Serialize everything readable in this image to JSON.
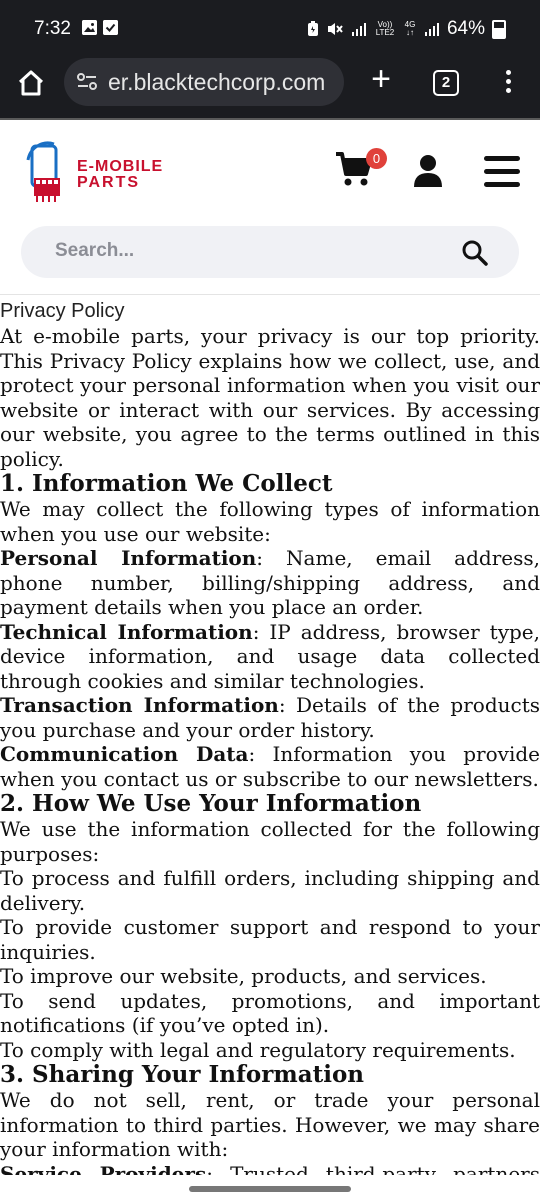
{
  "status": {
    "time": "7:32",
    "lte_top": "Vo))",
    "lte_bottom": "LTE2",
    "net_top": "4G",
    "battery": "64%"
  },
  "browser": {
    "url": "er.blacktechcorp.com",
    "tab_count": "2"
  },
  "site": {
    "logo_line1": "E-MOBILE",
    "logo_line2": "PARTS",
    "cart_count": "0",
    "search_placeholder": "Search..."
  },
  "policy": {
    "title": "Privacy Policy",
    "intro": "At e-mobile parts, your privacy is our top priority. This Privacy Policy explains how we collect, use, and protect your personal information when you visit our website or interact with our services. By accessing our website, you agree to the terms outlined in this policy.",
    "s1_heading": "1. Information We Collect",
    "s1_intro": "We may collect the following types of information when you use our website:",
    "s1_items": [
      {
        "label": "Personal Information",
        "text": ": Name, email address, phone number, billing/shipping address, and payment details when you place an order."
      },
      {
        "label": "Technical Information",
        "text": ": IP address, browser type, device information, and usage data collected through cookies and similar technologies."
      },
      {
        "label": "Transaction Information",
        "text": ": Details of the products you purchase and your order history."
      },
      {
        "label": "Communication Data",
        "text": ": Information you provide when you contact us or subscribe to our newsletters."
      }
    ],
    "s2_heading": "2. How We Use Your Information",
    "s2_intro": "We use the information collected for the following purposes:",
    "s2_items": [
      "To process and fulfill orders, including shipping and delivery.",
      "To provide customer support and respond to your inquiries.",
      "To improve our website, products, and services.",
      "To send updates, promotions, and important notifications (if you’ve opted in).",
      "To comply with legal and regulatory requirements."
    ],
    "s3_heading": "3. Sharing Your Information",
    "s3_intro": "We do not sell, rent, or trade your personal information to third parties. However, we may share your information with:",
    "s3_item_label": "Service Providers",
    "s3_item_text": ": Trusted third-party partners who"
  }
}
